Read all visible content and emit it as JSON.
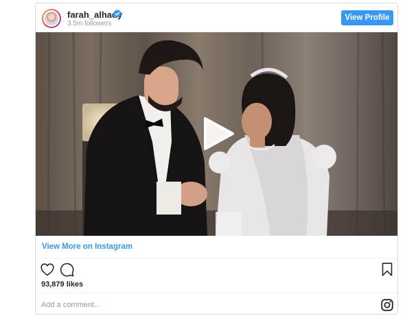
{
  "header": {
    "username": "farah_alhady",
    "followers": "3.5m followers",
    "view_profile_label": "View Profile",
    "verified_icon": "verified-badge-icon"
  },
  "media": {
    "type": "video",
    "play_icon": "play-icon"
  },
  "links": {
    "view_more_label": "View More on Instagram"
  },
  "actions": {
    "like_icon": "heart-icon",
    "comment_icon": "comment-icon",
    "save_icon": "bookmark-icon"
  },
  "stats": {
    "likes": "93,879 likes"
  },
  "comment_box": {
    "placeholder": "Add a comment...",
    "logo_icon": "instagram-icon"
  },
  "colors": {
    "accent": "#3897f0",
    "border": "#dbdbdb",
    "muted_text": "#999999",
    "text": "#262626"
  }
}
